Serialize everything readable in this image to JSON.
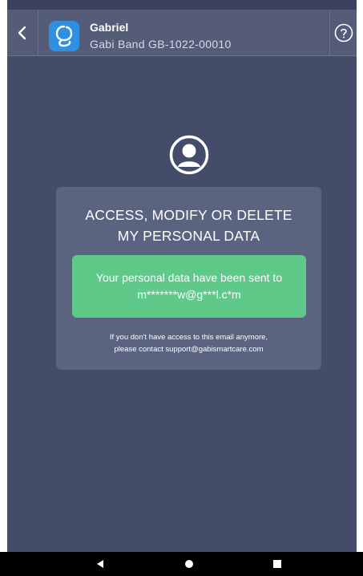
{
  "header": {
    "title": "Gabriel",
    "subtitle": "Gabi Band GB-1022-00010",
    "back_icon": "chevron-left-icon",
    "help_icon": "help-circle-icon",
    "app_icon": "gabi-app-icon"
  },
  "card": {
    "title_line1": "ACCESS, MODIFY OR DELETE",
    "title_line2": "MY PERSONAL DATA",
    "message_line1": "Your personal data have been sent to",
    "message_line2": "m*******w@g***l.c*m",
    "note_line1": "If you don't have access to this email anymore,",
    "note_line2": "please contact support@gabismartcare.com"
  },
  "colors": {
    "background": "#434c68",
    "header": "#545c78",
    "card": "#5a6380",
    "success": "#5fc98a",
    "app_icon": "#2f8fe0"
  },
  "navbar": {
    "icons": [
      "back-triangle-icon",
      "home-circle-icon",
      "recents-square-icon"
    ]
  }
}
